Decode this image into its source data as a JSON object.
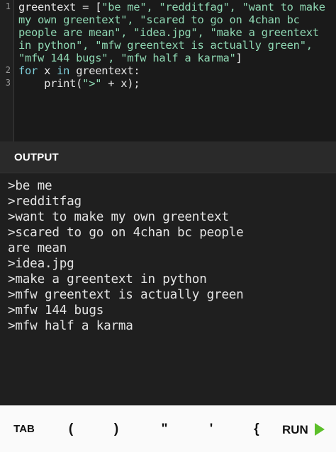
{
  "editor": {
    "line_numbers": [
      "1",
      "2",
      "3"
    ],
    "lines": [
      "greentext = [\"be me\", \"redditfag\", \"want to make",
      "my own greentext\", \"scared to go on 4chan bc",
      "people are mean\", \"idea.jpg\", \"make a greentext",
      "in python\", \"mfw greentext is actually green\",",
      "\"mfw 144 bugs\", \"mfw half a karma\"]",
      "for x in greentext:",
      "    print(\">\" + x);"
    ],
    "segments": {
      "l1_var": "greentext = [",
      "l1_str": "\"be me\", \"redditfag\", \"want to make",
      "l2_str": "my own greentext\", \"scared to go on 4chan bc",
      "l3_str": "people are mean\", \"idea.jpg\", \"make a greentext",
      "l4_str": "in python\", \"mfw greentext is actually green\",",
      "l5_str": "\"mfw 144 bugs\", \"mfw half a karma\"",
      "l5_close": "]",
      "for_kw": "for",
      "for_var": " x ",
      "in_kw": "in",
      "for_rest": " greentext:",
      "print_fn": "    print(",
      "print_str": "\">\"",
      "print_rest": " + x);"
    }
  },
  "output": {
    "title": "OUTPUT",
    "lines": [
      ">be me",
      ">redditfag",
      ">want to make my own greentext",
      ">scared to go on 4chan bc people",
      "are mean",
      ">idea.jpg",
      ">make a greentext in python",
      ">mfw greentext is actually green",
      ">mfw 144 bugs",
      ">mfw half a karma"
    ]
  },
  "toolbar": {
    "tab_label": "TAB",
    "keys": [
      "(",
      ")",
      "\"",
      "'",
      "{"
    ],
    "run_label": "RUN",
    "run_icon": "play-icon"
  },
  "colors": {
    "string": "#8fd8b3",
    "keyword": "#7fd0dc",
    "run_accent": "#5cbf2a"
  }
}
